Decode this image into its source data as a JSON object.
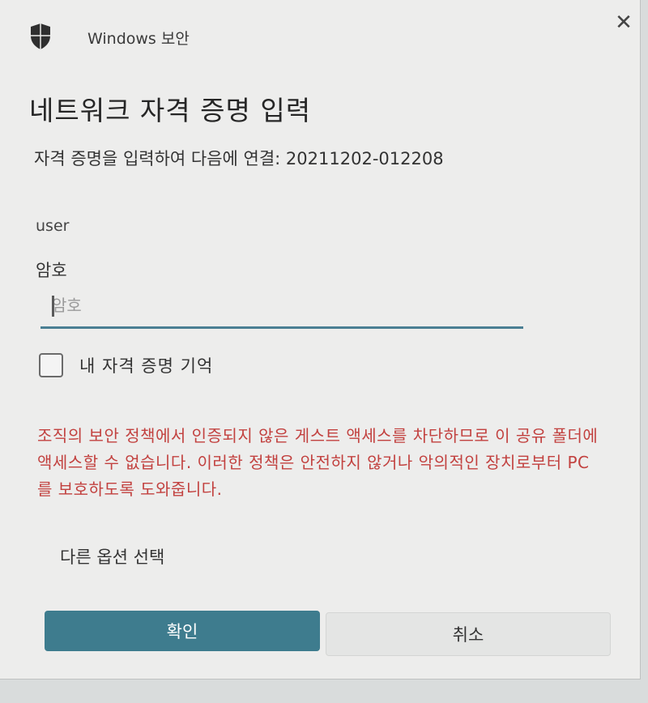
{
  "window": {
    "app_title": "Windows 보안",
    "close_glyph": "✕"
  },
  "dialog": {
    "heading": "네트워크 자격 증명 입력",
    "subtitle": "자격 증명을 입력하여 다음에 연결: 20211202-012208",
    "username": "user",
    "password_label": "암호",
    "password_placeholder": "암호",
    "password_value": "",
    "remember_label": "내 자격 증명 기억",
    "remember_checked": false,
    "warning_text": "조직의 보안 정책에서 인증되지 않은 게스트 액세스를 차단하므로 이 공유 폴더에 액세스할 수 없습니다. 이러한 정책은 안전하지 않거나 악의적인 장치로부터 PC를 보호하도록 도와줍니다.",
    "other_options_label": "다른 옵션 선택",
    "ok_label": "확인",
    "cancel_label": "취소"
  },
  "icons": {
    "shield": "shield-icon",
    "close": "close-icon"
  },
  "colors": {
    "accent": "#3e7c8e",
    "warning": "#c2413f",
    "input_underline": "#4a7f93"
  }
}
